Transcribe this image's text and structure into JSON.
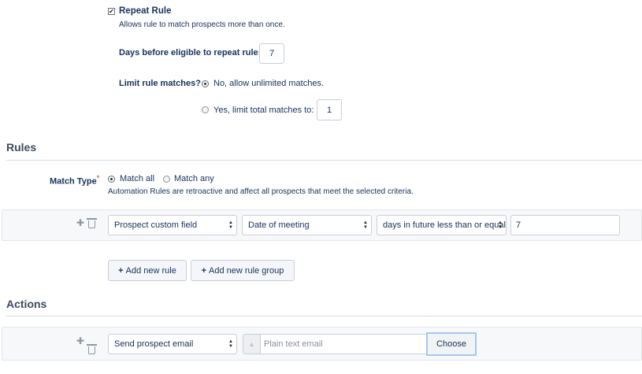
{
  "repeat": {
    "checkbox_mark": "✔",
    "label": "Repeat Rule",
    "description": "Allows rule to match prospects more than once.",
    "days_label": "Days before eligible to repeat rule:",
    "days_value": "7",
    "limit_label": "Limit rule matches?",
    "option_unlimited": "No, allow unlimited matches.",
    "option_limit": "Yes, limit total matches to:",
    "limit_value": "1"
  },
  "rules": {
    "title": "Rules",
    "match_type_label": "Match Type",
    "required_mark": "*",
    "match_all": "Match all",
    "match_any": "Match any",
    "note": "Automation Rules are retroactive and affect all prospects that meet the selected criteria.",
    "row": {
      "field_type": "Prospect custom field",
      "field": "Date of meeting",
      "operator": "days in future less than or equal to",
      "value": "7"
    },
    "add_rule": "Add new rule",
    "add_group": "Add new rule group"
  },
  "actions": {
    "title": "Actions",
    "action": "Send prospect email",
    "email_placeholder": "Plain text email",
    "choose": "Choose"
  },
  "icons": {
    "plus": "✚",
    "select_up": "▲",
    "select_down": "▼"
  },
  "colors": {
    "text": "#16325c",
    "required": "#e9692c",
    "choose_focus": "#a6c8ec"
  }
}
